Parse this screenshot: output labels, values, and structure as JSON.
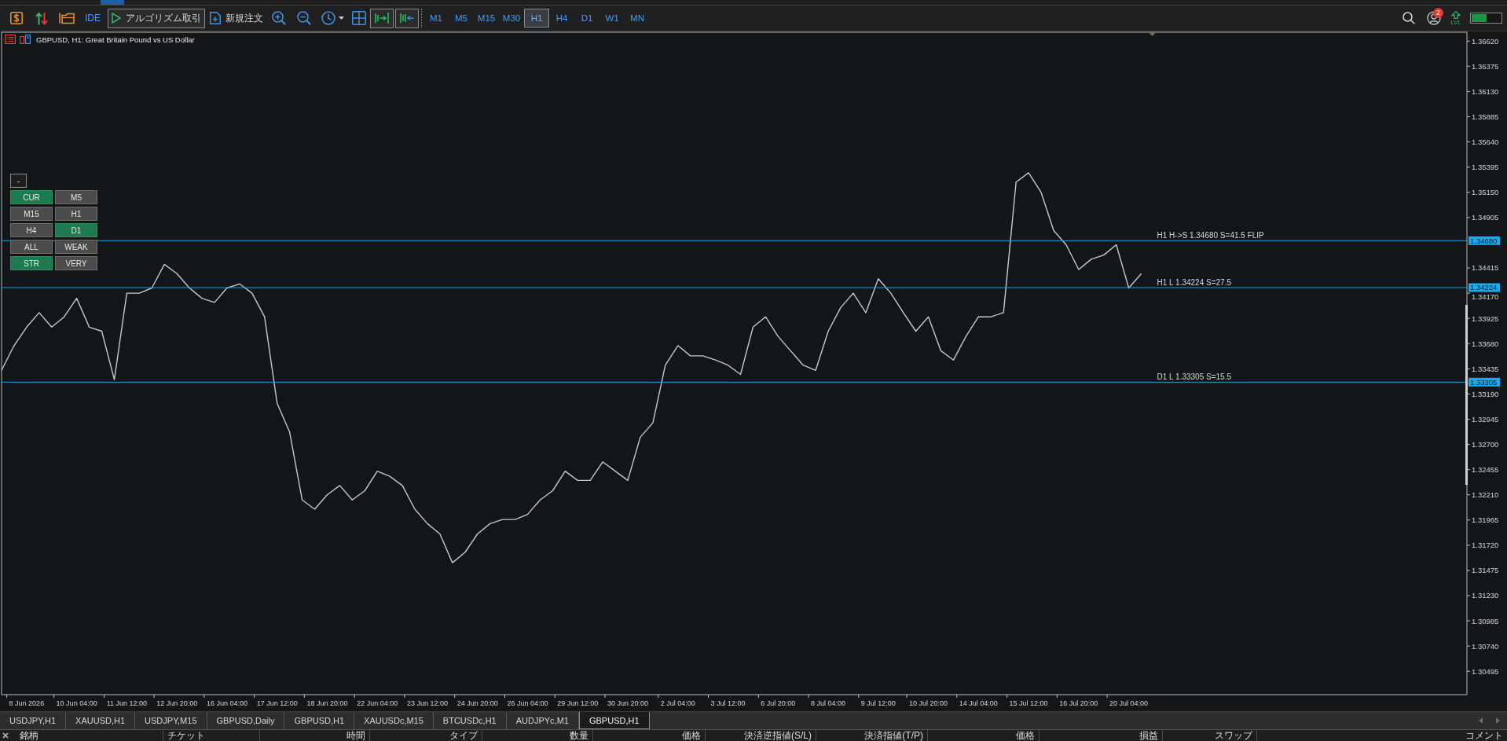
{
  "toolbar": {
    "ide_button": "IDE",
    "algo_trading_button": {
      "label": "アルゴリズム取引",
      "on": true
    },
    "new_order_button": "新規注文",
    "auto_scroll_button": {
      "on": true
    },
    "chart_shift_button": {
      "on": true
    },
    "timeframes": [
      {
        "label": "M1",
        "selected": false
      },
      {
        "label": "M5",
        "selected": false
      },
      {
        "label": "M15",
        "selected": false
      },
      {
        "label": "M30",
        "selected": false
      },
      {
        "label": "H1",
        "selected": true
      },
      {
        "label": "H4",
        "selected": false
      },
      {
        "label": "D1",
        "selected": false
      },
      {
        "label": "W1",
        "selected": false
      },
      {
        "label": "MN",
        "selected": false
      }
    ],
    "notification_badge": "2",
    "lvl_button": "LVL"
  },
  "chart": {
    "title": "GBPUSD, H1: Great Britain Pound vs US Dollar",
    "indicator_panel": {
      "collapse_button": "-",
      "buttons": [
        {
          "label": "CUR",
          "selected": true
        },
        {
          "label": "M5",
          "selected": false
        },
        {
          "label": "M15",
          "selected": false
        },
        {
          "label": "H1",
          "selected": false
        },
        {
          "label": "H4",
          "selected": false
        },
        {
          "label": "D1",
          "selected": true
        },
        {
          "label": "ALL",
          "selected": false
        },
        {
          "label": "WEAK",
          "selected": false
        },
        {
          "label": "STR",
          "selected": true
        },
        {
          "label": "VERY",
          "selected": false
        }
      ]
    },
    "chart_data": {
      "type": "line",
      "ylim": [
        1.30268,
        1.36706
      ],
      "categories": [
        null,
        null,
        "8 Jun 2026",
        null,
        null,
        null,
        "10 Jun 04:00",
        null,
        null,
        null,
        "11 Jun 12:00",
        null,
        null,
        null,
        "12 Jun 20:00",
        null,
        null,
        null,
        "16 Jun 04:00",
        null,
        null,
        null,
        "17 Jun 12:00",
        null,
        null,
        null,
        "18 Jun 20:00",
        null,
        null,
        null,
        "22 Jun 04:00",
        null,
        null,
        null,
        "23 Jun 12:00",
        null,
        null,
        null,
        "24 Jun 20:00",
        null,
        null,
        null,
        "26 Jun 04:00",
        null,
        null,
        null,
        "29 Jun 12:00",
        null,
        null,
        null,
        "30 Jun 20:00",
        null,
        null,
        null,
        "2 Jul 04:00",
        null,
        null,
        null,
        "3 Jul 12:00",
        null,
        null,
        null,
        "6 Jul 20:00",
        null,
        null,
        null,
        "8 Jul 04:00",
        null,
        null,
        null,
        "9 Jul 12:00",
        null,
        null,
        null,
        "10 Jul 20:00",
        null,
        null,
        null,
        "14 Jul 04:00",
        null,
        null,
        null,
        "15 Jul 12:00",
        null,
        null,
        null,
        "16 Jul 20:00",
        null,
        null,
        null,
        "20 Jul 04:00",
        null,
        null,
        null,
        null,
        null,
        null,
        null,
        null,
        null,
        null,
        null,
        null,
        null,
        null,
        null,
        null,
        null,
        null,
        null,
        null,
        null,
        null,
        null,
        null,
        null,
        null
      ],
      "series": [
        {
          "color": "#c8c8c8",
          "values": [
            1.3342,
            1.3366,
            1.3384,
            1.3398,
            1.3384,
            1.3394,
            1.3412,
            1.3384,
            1.338,
            1.3333,
            1.3417,
            1.3417,
            1.3422,
            1.3445,
            1.3436,
            1.3422,
            1.3412,
            1.3408,
            1.3422,
            1.3426,
            1.3417,
            1.3394,
            1.331,
            1.3282,
            1.3216,
            1.3207,
            1.3221,
            1.323,
            1.3216,
            1.3225,
            1.3244,
            1.3239,
            1.323,
            1.3207,
            1.3193,
            1.3183,
            1.3155,
            1.3165,
            1.3183,
            1.3193,
            1.3197,
            1.3197,
            1.3202,
            1.3216,
            1.3225,
            1.3244,
            1.3235,
            1.3235,
            1.3253,
            1.3244,
            1.3235,
            1.3277,
            1.3291,
            1.3347,
            1.3366,
            1.3356,
            1.3356,
            1.3352,
            1.3347,
            1.3338,
            1.3384,
            1.3394,
            1.3375,
            1.3361,
            1.3347,
            1.3342,
            1.338,
            1.3403,
            1.3417,
            1.3398,
            1.3431,
            1.3417,
            1.3398,
            1.338,
            1.3394,
            1.3361,
            1.3352,
            1.3375,
            1.3394,
            1.3394,
            1.3398,
            1.3525,
            1.3534,
            1.3515,
            1.3478,
            1.3464,
            1.344,
            1.345,
            1.3454,
            1.3464,
            1.3422,
            1.3436,
            null,
            null,
            null,
            null,
            null,
            null,
            null,
            null,
            null,
            null,
            null,
            null,
            null,
            null,
            null,
            null,
            null,
            null,
            null,
            null,
            null,
            null,
            null,
            null,
            null
          ]
        }
      ],
      "yticks": [
        {
          "value": 1.3662,
          "label": "1.36620"
        },
        {
          "value": 1.36375,
          "label": "1.36375"
        },
        {
          "value": 1.3613,
          "label": "1.36130"
        },
        {
          "value": 1.35885,
          "label": "1.35885"
        },
        {
          "value": 1.3564,
          "label": "1.35640"
        },
        {
          "value": 1.35395,
          "label": "1.35395"
        },
        {
          "value": 1.3515,
          "label": "1.35150"
        },
        {
          "value": 1.34905,
          "label": "1.34905"
        },
        {
          "value": 1.34415,
          "label": "1.34415"
        },
        {
          "value": 1.3417,
          "label": "1.34170"
        },
        {
          "value": 1.33925,
          "label": "1.33925"
        },
        {
          "value": 1.3368,
          "label": "1.33680"
        },
        {
          "value": 1.33435,
          "label": "1.33435"
        },
        {
          "value": 1.3319,
          "label": "1.33190"
        },
        {
          "value": 1.32945,
          "label": "1.32945"
        },
        {
          "value": 1.327,
          "label": "1.32700"
        },
        {
          "value": 1.32455,
          "label": "1.32455"
        },
        {
          "value": 1.3221,
          "label": "1.32210"
        },
        {
          "value": 1.31965,
          "label": "1.31965"
        },
        {
          "value": 1.3172,
          "label": "1.31720"
        },
        {
          "value": 1.31475,
          "label": "1.31475"
        },
        {
          "value": 1.3123,
          "label": "1.31230"
        },
        {
          "value": 1.30985,
          "label": "1.30985"
        },
        {
          "value": 1.3074,
          "label": "1.30740"
        },
        {
          "value": 1.30495,
          "label": "1.30495"
        }
      ],
      "ref_lines": [
        {
          "axis": "y",
          "value": 1.3468,
          "label": "H1 H->S 1.34680 S=41.5 FLIP"
        },
        {
          "axis": "y",
          "value": 1.34224,
          "label": "H1 L 1.34224 S=27.5"
        },
        {
          "axis": "y",
          "value": 1.33305,
          "label": "D1 L 1.33305 S=15.5"
        }
      ]
    },
    "price_tags": [
      "1.34680",
      "1.34224",
      "1.33305"
    ]
  },
  "chart_tabs": [
    {
      "label": "USDJPY,H1",
      "selected": false
    },
    {
      "label": "XAUUSD,H1",
      "selected": false
    },
    {
      "label": "USDJPY,M15",
      "selected": false
    },
    {
      "label": "GBPUSD,Daily",
      "selected": false
    },
    {
      "label": "GBPUSD,H1",
      "selected": false
    },
    {
      "label": "XAUUSDc,M15",
      "selected": false
    },
    {
      "label": "BTCUSDc,H1",
      "selected": false
    },
    {
      "label": "AUDJPYc,M1",
      "selected": false
    },
    {
      "label": "GBPUSD,H1",
      "selected": true
    }
  ],
  "trade_table": {
    "columns": [
      "銘柄",
      "チケット",
      "時間",
      "タイプ",
      "数量",
      "価格",
      "決済逆指値(S/L)",
      "決済指値(T/P)",
      "価格",
      "損益",
      "スワップ",
      "コメント"
    ]
  }
}
